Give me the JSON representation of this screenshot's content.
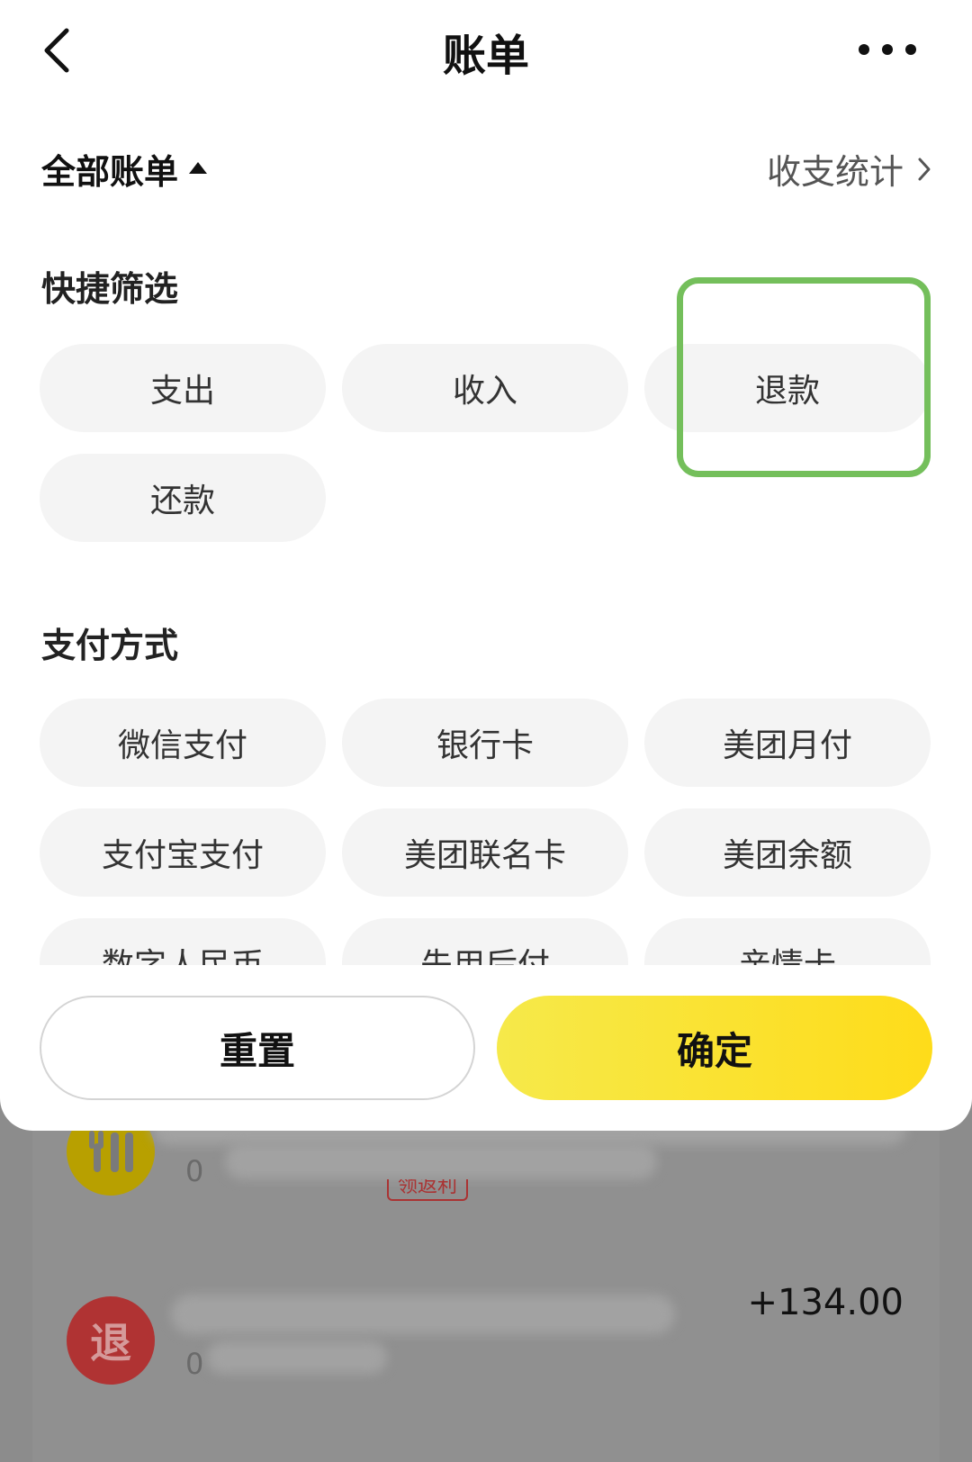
{
  "nav": {
    "back_icon": "chevron-left-icon",
    "title": "账单",
    "more_icon": "more-dots-icon"
  },
  "filter_bar": {
    "all_bills_label": "全部账单",
    "stats_label": "收支统计"
  },
  "quick_filter": {
    "title": "快捷筛选",
    "chips": [
      "支出",
      "收入",
      "退款",
      "还款"
    ],
    "highlighted": "退款",
    "highlight_color": "#74bf5b"
  },
  "payment_method": {
    "title": "支付方式",
    "chips": [
      "微信支付",
      "银行卡",
      "美团月付",
      "支付宝支付",
      "美团联名卡",
      "美团余额",
      "数字人民币",
      "先用后付",
      "亲情卡"
    ]
  },
  "actions": {
    "reset_label": "重置",
    "confirm_label": "确定",
    "confirm_color": "#fedc1a"
  },
  "background_list": {
    "row1": {
      "icon_symbol": "",
      "icon_name": "fork-knife-icon",
      "sub_text": "0",
      "tag": "领返利"
    },
    "row2": {
      "icon_symbol": "退",
      "sub_text": "0",
      "amount": "+134.00"
    }
  }
}
